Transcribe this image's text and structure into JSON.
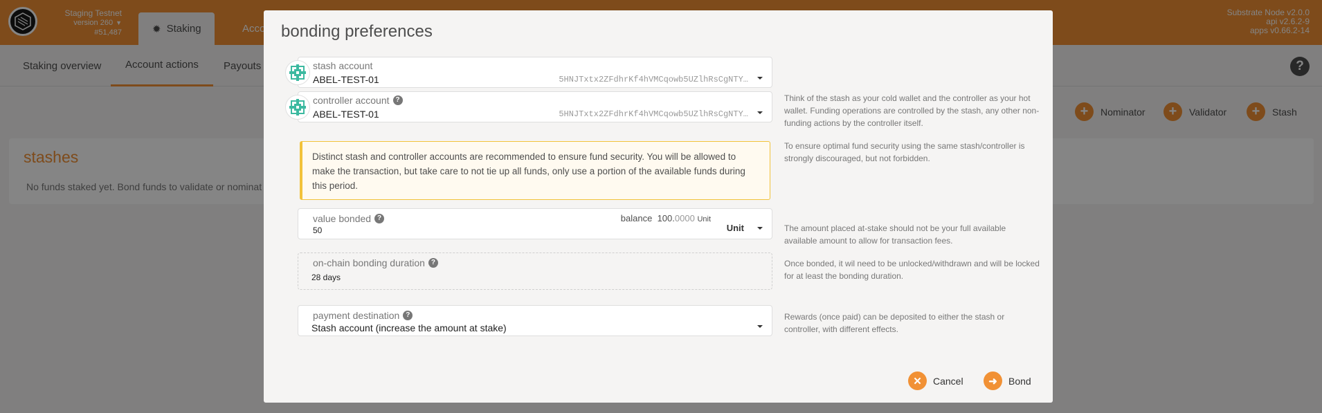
{
  "colors": {
    "accent": "#f19135",
    "warning_border": "#f2c23a",
    "warning_bg": "#fffaf0"
  },
  "app": {
    "chain_name": "Staging Testnet",
    "version": "version 260",
    "block": "#51,487",
    "nav_tabs": [
      {
        "label": "Staking",
        "icon": "gear-icon"
      },
      {
        "label": "Accou"
      }
    ],
    "node": {
      "name": "Substrate Node v2.0.0",
      "api": "api v2.6.2-9",
      "apps": "apps v0.66.2-14"
    },
    "subtabs": [
      "Staking overview",
      "Account actions",
      "Payouts"
    ],
    "actions": [
      "Nominator",
      "Validator",
      "Stash"
    ],
    "stashes": {
      "title": "stashes",
      "empty_text": "No funds staked yet. Bond funds to validate or nominat"
    }
  },
  "modal": {
    "title": "bonding preferences",
    "stash": {
      "label": "stash account",
      "value": "ABEL-TEST-01",
      "address": "5HNJTxtx2ZFdhrKf4hVMCqowb5UZlhRsCgNTY…"
    },
    "controller": {
      "label": "controller account",
      "value": "ABEL-TEST-01",
      "address": "5HNJTxtx2ZFdhrKf4hVMCqowb5UZlhRsCgNTY…"
    },
    "warning": "Distinct stash and controller accounts are recommended to ensure fund security. You will be allowed to make the transaction, but take care to not tie up all funds, only use a portion of the available funds during this period.",
    "value_bonded": {
      "label": "value bonded",
      "value": "50",
      "balance_label": "balance",
      "balance_int": "100.",
      "balance_dec": "0000",
      "balance_unit": "Unit",
      "unit_select": "Unit"
    },
    "duration": {
      "label": "on-chain bonding duration",
      "value": "28 days"
    },
    "payment": {
      "label": "payment destination",
      "value": "Stash account (increase the amount at stake)"
    },
    "help": {
      "accounts": "Think of the stash as your cold wallet and the controller as your hot wallet. Funding operations are controlled by the stash, any other non-funding actions by the controller itself.",
      "security": "To ensure optimal fund security using the same stash/controller is strongly discouraged, but not forbidden.",
      "amount": "The amount placed at-stake should not be your full available available amount to allow for transaction fees.",
      "duration": "Once bonded, it wil need to be unlocked/withdrawn and will be locked for at least the bonding duration.",
      "rewards": "Rewards (once paid) can be deposited to either the stash or controller, with different effects."
    },
    "buttons": {
      "cancel": "Cancel",
      "bond": "Bond"
    }
  }
}
